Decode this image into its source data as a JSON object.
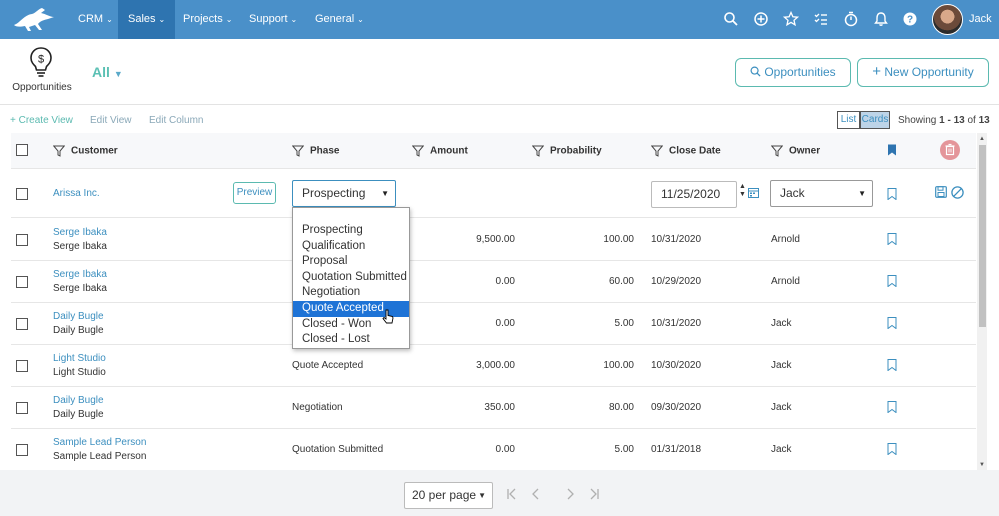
{
  "nav": {
    "items": [
      {
        "label": "CRM",
        "active": false
      },
      {
        "label": "Sales",
        "active": true
      },
      {
        "label": "Projects",
        "active": false
      },
      {
        "label": "Support",
        "active": false
      },
      {
        "label": "General",
        "active": false
      }
    ],
    "user_name": "Jack",
    "icons": [
      "search-icon",
      "add-circle-icon",
      "star-icon",
      "tasks-icon",
      "timer-icon",
      "bell-icon",
      "help-icon"
    ]
  },
  "header": {
    "page_label": "Opportunities",
    "view_label": "All",
    "search_button": "Opportunities",
    "new_button": "New Opportunity"
  },
  "toolbar": {
    "create_view": "+ Create View",
    "edit_view": "Edit View",
    "edit_column": "Edit Column",
    "list_label": "List",
    "cards_label": "Cards",
    "showing_prefix": "Showing ",
    "showing_range": "1 - 13",
    "showing_of": " of ",
    "showing_total": "13"
  },
  "columns": {
    "customer": "Customer",
    "phase": "Phase",
    "amount": "Amount",
    "probability": "Probability",
    "close_date": "Close Date",
    "owner": "Owner"
  },
  "edit_row": {
    "customer": "Arissa Inc.",
    "preview": "Preview",
    "phase_value": "Prospecting",
    "close_date": "11/25/2020",
    "owner_value": "Jack"
  },
  "phase_options": [
    "Prospecting",
    "Qualification",
    "Proposal",
    "Quotation Submitted",
    "Negotiation",
    "Quote Accepted",
    "Closed - Won",
    "Closed - Lost"
  ],
  "phase_highlighted": "Quote Accepted",
  "rows": [
    {
      "customer": "Serge Ibaka",
      "contact": "Serge Ibaka",
      "phase": "",
      "amount": "9,500.00",
      "probability": "100.00",
      "close_date": "10/31/2020",
      "owner": "Arnold"
    },
    {
      "customer": "Serge Ibaka",
      "contact": "Serge Ibaka",
      "phase": "",
      "amount": "0.00",
      "probability": "60.00",
      "close_date": "10/29/2020",
      "owner": "Arnold"
    },
    {
      "customer": "Daily Bugle",
      "contact": "Daily Bugle",
      "phase": "",
      "amount": "0.00",
      "probability": "5.00",
      "close_date": "10/31/2020",
      "owner": "Jack"
    },
    {
      "customer": "Light Studio",
      "contact": "Light Studio",
      "phase": "Quote Accepted",
      "amount": "3,000.00",
      "probability": "100.00",
      "close_date": "10/30/2020",
      "owner": "Jack"
    },
    {
      "customer": "Daily Bugle",
      "contact": "Daily Bugle",
      "phase": "Negotiation",
      "amount": "350.00",
      "probability": "80.00",
      "close_date": "09/30/2020",
      "owner": "Jack"
    },
    {
      "customer": "Sample Lead Person",
      "contact": "Sample Lead Person",
      "phase": "Quotation Submitted",
      "amount": "0.00",
      "probability": "5.00",
      "close_date": "01/31/2018",
      "owner": "Jack"
    }
  ],
  "footer": {
    "per_page": "20 per page"
  },
  "colors": {
    "nav_bg": "#4a90c9",
    "nav_active": "#2e74b0",
    "accent_teal": "#5bbab0",
    "link_blue": "#3c8fbf",
    "highlight": "#1e73d6"
  }
}
